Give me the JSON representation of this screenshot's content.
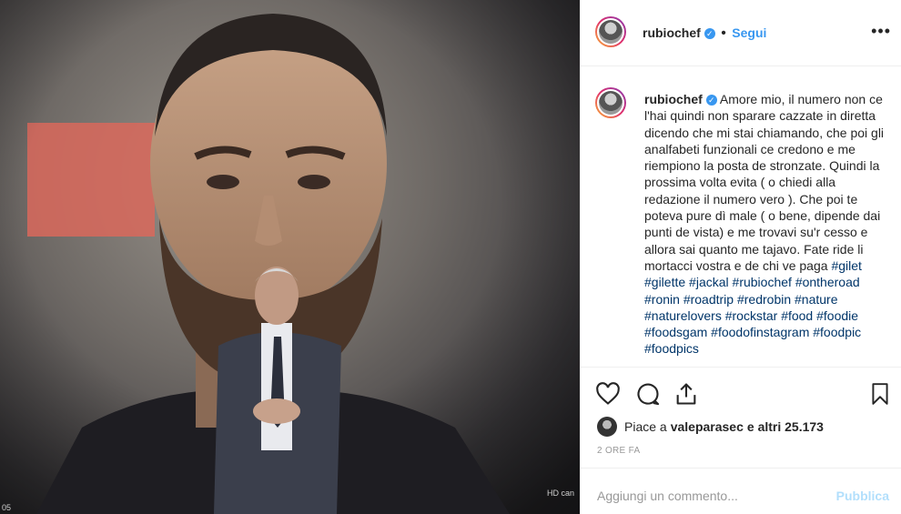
{
  "post": {
    "username": "rubiochef",
    "follow_label": "Segui",
    "follow_separator": "•",
    "more_label": "•••",
    "verified_mark": "✓",
    "caption_text": "Amore mio, il numero non ce l'hai quindi non sparare cazzate in diretta dicendo che mi stai chiamando, che poi gli analfabeti funzionali ce credono e me riempiono la posta de stronzate. Quindi la prossima volta evita ( o chiedi alla redazione il numero vero ). Che poi te poteva pure dì male ( o bene, dipende dai punti de vista) e me trovavi su'r cesso e allora sai quanto me tajavo. Fate ride li mortacci vostra e de chi ve paga",
    "hashtags": [
      "#gilet",
      "#gilette",
      "#jackal",
      "#rubiochef",
      "#ontheroad",
      "#ronin",
      "#roadtrip",
      "#redrobin",
      "#nature",
      "#naturelovers",
      "#rockstar",
      "#food",
      "#foodie",
      "#foodsgam",
      "#foodofinstagram",
      "#foodpic",
      "#foodpics"
    ],
    "likes_prefix": "Piace a ",
    "likes_user": "valeparasec",
    "likes_suffix": " e altri 25.173",
    "timestamp": "2 ORE FA",
    "comment_placeholder": "Aggiungi un commento...",
    "publish_label": "Pubblica"
  },
  "photo": {
    "overlay_text": "HD can",
    "corner_number": "05"
  },
  "icons": {
    "like": "heart-icon",
    "comment": "comment-icon",
    "share": "share-icon",
    "save": "bookmark-icon",
    "options": "more-options-icon"
  },
  "colors": {
    "link_blue": "#3897f0",
    "hashtag": "#003569",
    "muted": "#999999",
    "publish_disabled": "#b2dffc"
  }
}
